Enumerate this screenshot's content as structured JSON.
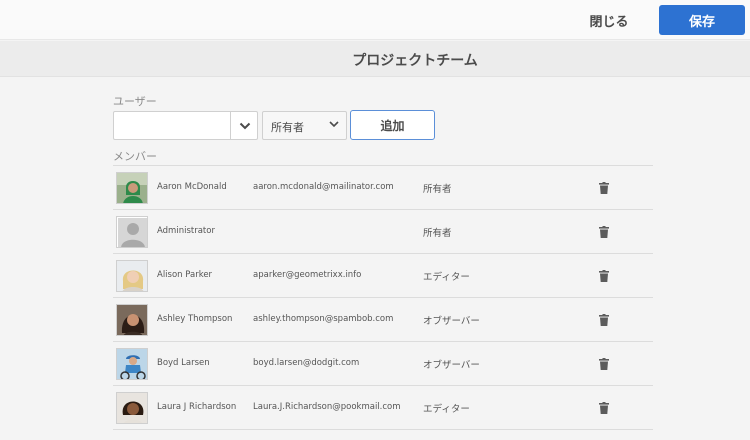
{
  "toolbar": {
    "close_label": "閉じる",
    "save_label": "保存",
    "accent": "#2d72d2"
  },
  "page": {
    "title": "プロジェクトチーム"
  },
  "user_section": {
    "label": "ユーザー",
    "input_value": "",
    "role_selected": "所有者",
    "add_label": "追加"
  },
  "members_section": {
    "label": "メンバー"
  },
  "members": [
    {
      "name": "Aaron McDonald",
      "email": "aaron.mcdonald@mailinator.com",
      "role": "所有者",
      "avatar": "photo-green-hoodie"
    },
    {
      "name": "Administrator",
      "email": "",
      "role": "所有者",
      "avatar": "default-silhouette"
    },
    {
      "name": "Alison Parker",
      "email": "aparker@geometrixx.info",
      "role": "エディター",
      "avatar": "photo-blonde"
    },
    {
      "name": "Ashley Thompson",
      "email": "ashley.thompson@spambob.com",
      "role": "オブザーバー",
      "avatar": "photo-dark-hair"
    },
    {
      "name": "Boyd Larsen",
      "email": "boyd.larsen@dodgit.com",
      "role": "オブザーバー",
      "avatar": "photo-cyclist"
    },
    {
      "name": "Laura J Richardson",
      "email": "Laura.J.Richardson@pookmail.com",
      "role": "エディター",
      "avatar": "photo-curly-hair"
    }
  ]
}
